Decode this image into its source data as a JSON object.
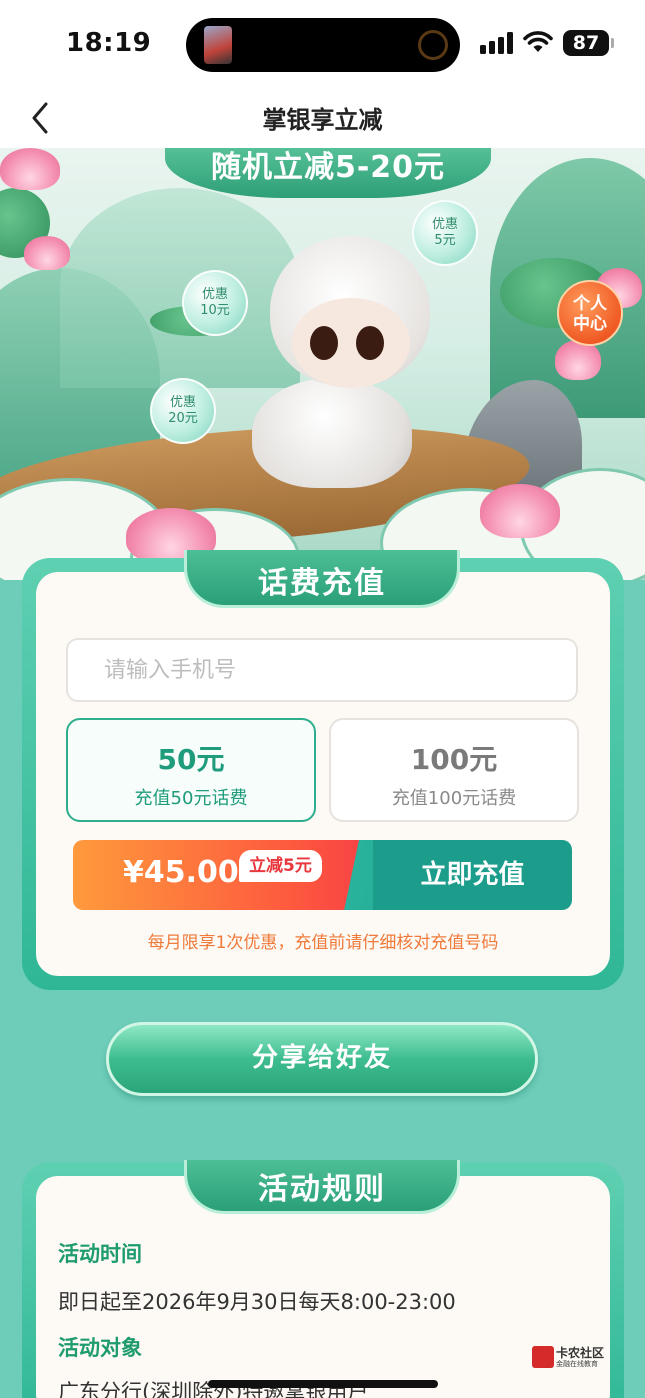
{
  "status_bar": {
    "time": "18:19",
    "battery": "87"
  },
  "nav": {
    "title": "掌银享立减",
    "back_icon": "chevron-left-icon"
  },
  "hero": {
    "banner": "随机立减5-20元",
    "bubbles": [
      {
        "line1": "优惠",
        "line2": "10元"
      },
      {
        "line1": "优惠",
        "line2": "5元"
      },
      {
        "line1": "优惠",
        "line2": "20元"
      }
    ],
    "personal_center": {
      "line1": "个人",
      "line2": "中心"
    }
  },
  "recharge": {
    "title": "话费充值",
    "phone_placeholder": "请输入手机号",
    "phone_value": "",
    "options": [
      {
        "amount": "50元",
        "desc": "充值50元话费",
        "selected": true
      },
      {
        "amount": "100元",
        "desc": "充值100元话费",
        "selected": false
      }
    ],
    "price": "¥45.00",
    "discount_badge": "立减5元",
    "pay_button": "立即充值",
    "note": "每月限享1次优惠，充值前请仔细核对充值号码",
    "colors": {
      "accent": "#1f9c7c",
      "pay_gradient_start": "#ff9a3c",
      "pay_gradient_end": "#f63c47",
      "pay_button": "#1c9d8c",
      "note": "#f07a3a"
    }
  },
  "share": {
    "label": "分享给好友"
  },
  "rules": {
    "title": "活动规则",
    "sections": [
      {
        "heading": "活动时间",
        "text": "即日起至2026年9月30日每天8:00-23:00"
      },
      {
        "heading": "活动对象",
        "text": "广东分行(深圳除外)特邀掌银用户"
      }
    ]
  },
  "watermark": {
    "title": "卡农社区",
    "subtitle": "金融在线教育"
  },
  "colors": {
    "page_background": "#6dcdb9",
    "frame": "#2fb795",
    "heading_green": "#1f9c6f"
  }
}
